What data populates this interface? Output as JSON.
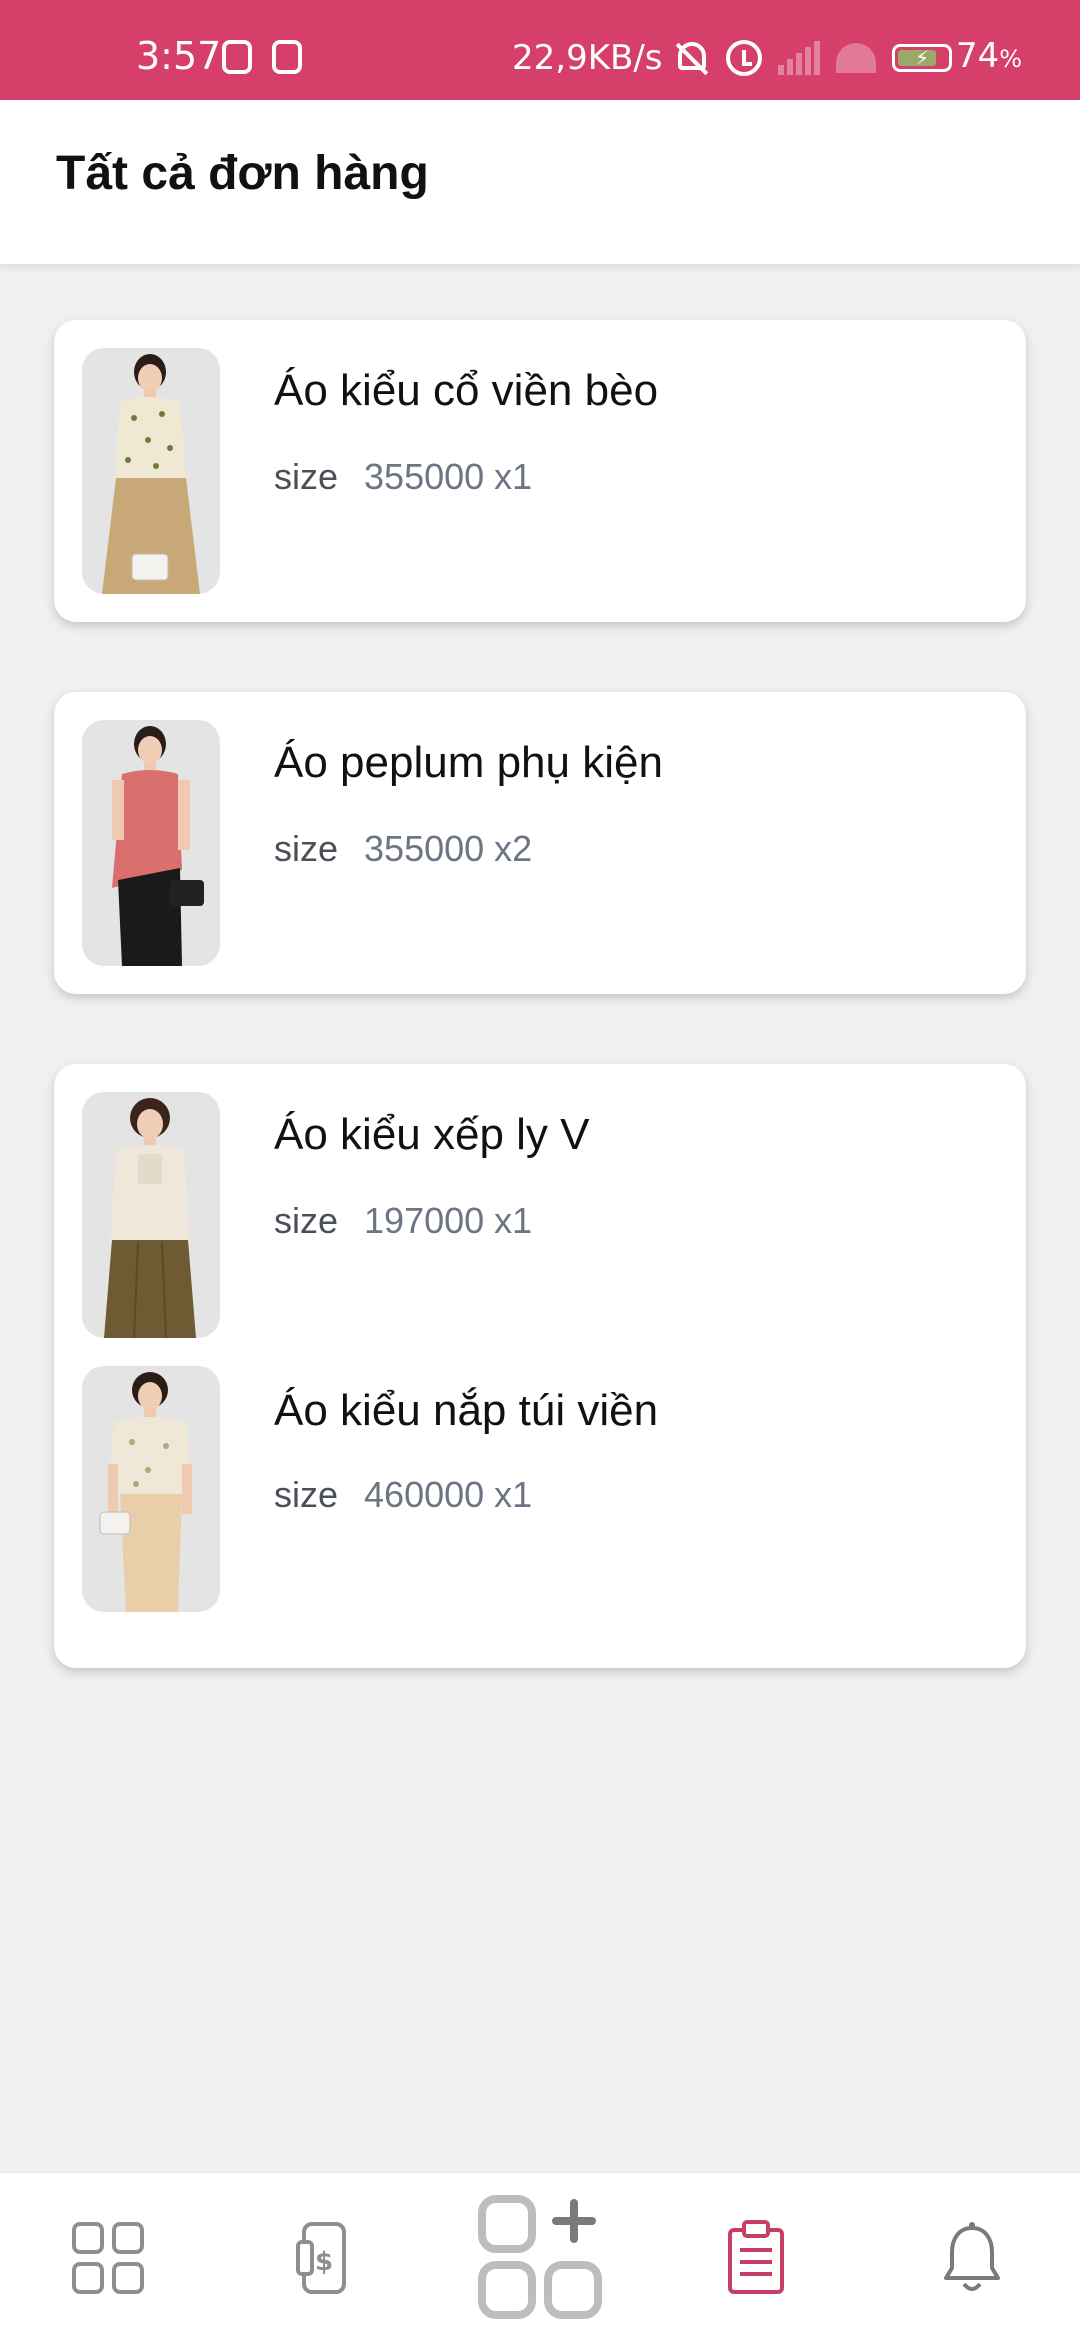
{
  "status_bar": {
    "time": "3:57",
    "network_speed": "22,9KB/s",
    "battery_percent": "74",
    "battery_unit": "%",
    "accent": "#d63f69"
  },
  "header": {
    "title": "Tất cả đơn hàng"
  },
  "orders": [
    {
      "items": [
        {
          "name": "Áo kiểu cổ viền bèo",
          "size_label": "size",
          "price_qty": "355000 x1",
          "image": "floral-blouse-photo",
          "top_color": "#efe9d4",
          "bottom_color": "#c9a877"
        }
      ]
    },
    {
      "items": [
        {
          "name": "Áo peplum phụ kiện",
          "size_label": "size",
          "price_qty": "355000 x2",
          "image": "pink-peplum-photo",
          "top_color": "#d9706e",
          "bottom_color": "#1a1a1a"
        }
      ]
    },
    {
      "items": [
        {
          "name": "Áo kiểu xếp ly V",
          "size_label": "size",
          "price_qty": "197000 x1",
          "image": "cream-pleat-blouse-photo",
          "top_color": "#eee7da",
          "bottom_color": "#6e5b33"
        },
        {
          "name": "Áo kiểu nắp túi viền",
          "size_label": "size",
          "price_qty": "460000 x1",
          "image": "cream-pocket-blouse-photo",
          "top_color": "#f0e8d6",
          "bottom_color": "#e8cfaa"
        }
      ]
    }
  ],
  "bottom_nav": [
    {
      "icon": "grid-icon",
      "active": false
    },
    {
      "icon": "phone-payment-icon",
      "active": false
    },
    {
      "icon": "add-app-icon",
      "active": false
    },
    {
      "icon": "clipboard-icon",
      "active": true,
      "color": "#c73f63"
    },
    {
      "icon": "bell-icon",
      "active": false
    }
  ]
}
